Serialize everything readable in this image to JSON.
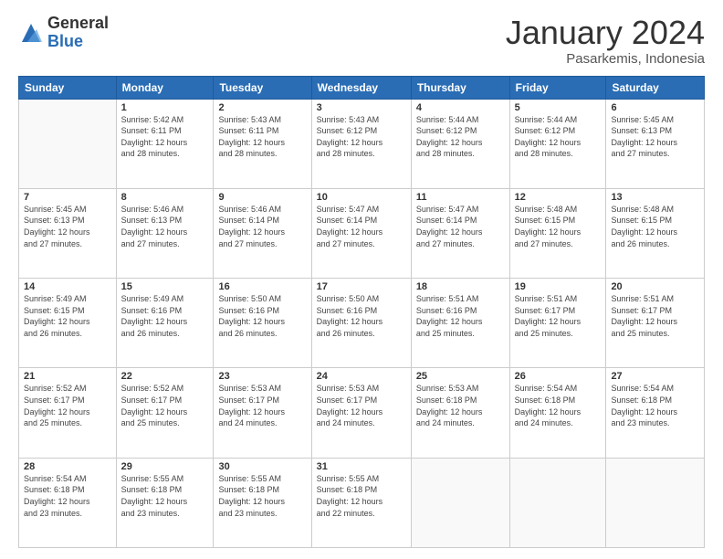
{
  "logo": {
    "general": "General",
    "blue": "Blue"
  },
  "header": {
    "title": "January 2024",
    "subtitle": "Pasarkemis, Indonesia"
  },
  "weekdays": [
    "Sunday",
    "Monday",
    "Tuesday",
    "Wednesday",
    "Thursday",
    "Friday",
    "Saturday"
  ],
  "weeks": [
    [
      {
        "day": "",
        "info": ""
      },
      {
        "day": "1",
        "info": "Sunrise: 5:42 AM\nSunset: 6:11 PM\nDaylight: 12 hours\nand 28 minutes."
      },
      {
        "day": "2",
        "info": "Sunrise: 5:43 AM\nSunset: 6:11 PM\nDaylight: 12 hours\nand 28 minutes."
      },
      {
        "day": "3",
        "info": "Sunrise: 5:43 AM\nSunset: 6:12 PM\nDaylight: 12 hours\nand 28 minutes."
      },
      {
        "day": "4",
        "info": "Sunrise: 5:44 AM\nSunset: 6:12 PM\nDaylight: 12 hours\nand 28 minutes."
      },
      {
        "day": "5",
        "info": "Sunrise: 5:44 AM\nSunset: 6:12 PM\nDaylight: 12 hours\nand 28 minutes."
      },
      {
        "day": "6",
        "info": "Sunrise: 5:45 AM\nSunset: 6:13 PM\nDaylight: 12 hours\nand 27 minutes."
      }
    ],
    [
      {
        "day": "7",
        "info": "Sunrise: 5:45 AM\nSunset: 6:13 PM\nDaylight: 12 hours\nand 27 minutes."
      },
      {
        "day": "8",
        "info": "Sunrise: 5:46 AM\nSunset: 6:13 PM\nDaylight: 12 hours\nand 27 minutes."
      },
      {
        "day": "9",
        "info": "Sunrise: 5:46 AM\nSunset: 6:14 PM\nDaylight: 12 hours\nand 27 minutes."
      },
      {
        "day": "10",
        "info": "Sunrise: 5:47 AM\nSunset: 6:14 PM\nDaylight: 12 hours\nand 27 minutes."
      },
      {
        "day": "11",
        "info": "Sunrise: 5:47 AM\nSunset: 6:14 PM\nDaylight: 12 hours\nand 27 minutes."
      },
      {
        "day": "12",
        "info": "Sunrise: 5:48 AM\nSunset: 6:15 PM\nDaylight: 12 hours\nand 27 minutes."
      },
      {
        "day": "13",
        "info": "Sunrise: 5:48 AM\nSunset: 6:15 PM\nDaylight: 12 hours\nand 26 minutes."
      }
    ],
    [
      {
        "day": "14",
        "info": "Sunrise: 5:49 AM\nSunset: 6:15 PM\nDaylight: 12 hours\nand 26 minutes."
      },
      {
        "day": "15",
        "info": "Sunrise: 5:49 AM\nSunset: 6:16 PM\nDaylight: 12 hours\nand 26 minutes."
      },
      {
        "day": "16",
        "info": "Sunrise: 5:50 AM\nSunset: 6:16 PM\nDaylight: 12 hours\nand 26 minutes."
      },
      {
        "day": "17",
        "info": "Sunrise: 5:50 AM\nSunset: 6:16 PM\nDaylight: 12 hours\nand 26 minutes."
      },
      {
        "day": "18",
        "info": "Sunrise: 5:51 AM\nSunset: 6:16 PM\nDaylight: 12 hours\nand 25 minutes."
      },
      {
        "day": "19",
        "info": "Sunrise: 5:51 AM\nSunset: 6:17 PM\nDaylight: 12 hours\nand 25 minutes."
      },
      {
        "day": "20",
        "info": "Sunrise: 5:51 AM\nSunset: 6:17 PM\nDaylight: 12 hours\nand 25 minutes."
      }
    ],
    [
      {
        "day": "21",
        "info": "Sunrise: 5:52 AM\nSunset: 6:17 PM\nDaylight: 12 hours\nand 25 minutes."
      },
      {
        "day": "22",
        "info": "Sunrise: 5:52 AM\nSunset: 6:17 PM\nDaylight: 12 hours\nand 25 minutes."
      },
      {
        "day": "23",
        "info": "Sunrise: 5:53 AM\nSunset: 6:17 PM\nDaylight: 12 hours\nand 24 minutes."
      },
      {
        "day": "24",
        "info": "Sunrise: 5:53 AM\nSunset: 6:17 PM\nDaylight: 12 hours\nand 24 minutes."
      },
      {
        "day": "25",
        "info": "Sunrise: 5:53 AM\nSunset: 6:18 PM\nDaylight: 12 hours\nand 24 minutes."
      },
      {
        "day": "26",
        "info": "Sunrise: 5:54 AM\nSunset: 6:18 PM\nDaylight: 12 hours\nand 24 minutes."
      },
      {
        "day": "27",
        "info": "Sunrise: 5:54 AM\nSunset: 6:18 PM\nDaylight: 12 hours\nand 23 minutes."
      }
    ],
    [
      {
        "day": "28",
        "info": "Sunrise: 5:54 AM\nSunset: 6:18 PM\nDaylight: 12 hours\nand 23 minutes."
      },
      {
        "day": "29",
        "info": "Sunrise: 5:55 AM\nSunset: 6:18 PM\nDaylight: 12 hours\nand 23 minutes."
      },
      {
        "day": "30",
        "info": "Sunrise: 5:55 AM\nSunset: 6:18 PM\nDaylight: 12 hours\nand 23 minutes."
      },
      {
        "day": "31",
        "info": "Sunrise: 5:55 AM\nSunset: 6:18 PM\nDaylight: 12 hours\nand 22 minutes."
      },
      {
        "day": "",
        "info": ""
      },
      {
        "day": "",
        "info": ""
      },
      {
        "day": "",
        "info": ""
      }
    ]
  ]
}
